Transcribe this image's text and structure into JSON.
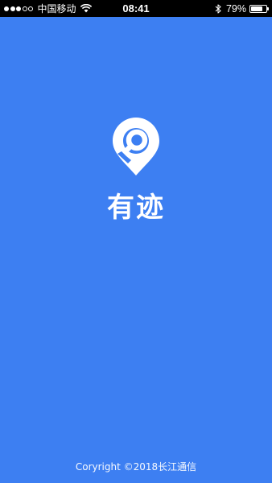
{
  "status_bar": {
    "signal_filled": 3,
    "signal_total": 5,
    "carrier": "中国移动",
    "time": "08:41",
    "battery_percent": "79%",
    "battery_level": 0.79,
    "icons": [
      "wifi-icon",
      "bluetooth-icon",
      "battery-icon"
    ]
  },
  "splash": {
    "app_name": "有迹",
    "logo_icon": "location-pin-logo",
    "copyright": "Coryright ©2018长江通信"
  },
  "colors": {
    "background": "#3d7ff2",
    "status_bar": "#000000",
    "foreground": "#ffffff"
  }
}
